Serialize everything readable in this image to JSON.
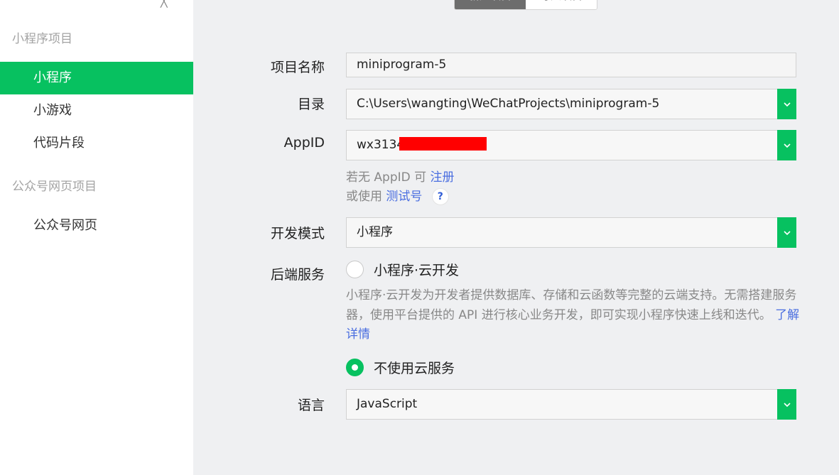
{
  "sidebar": {
    "sections": [
      {
        "title": "小程序项目",
        "items": [
          {
            "label": "小程序",
            "active": true
          },
          {
            "label": "小游戏",
            "active": false
          },
          {
            "label": "代码片段",
            "active": false
          }
        ]
      },
      {
        "title": "公众号网页项目",
        "items": [
          {
            "label": "公众号网页",
            "active": false
          }
        ]
      }
    ]
  },
  "tabs": [
    {
      "label": "新建项目",
      "active": true
    },
    {
      "label": "导入项目",
      "active": false
    }
  ],
  "form": {
    "project_name": {
      "label": "项目名称",
      "value": "miniprogram-5"
    },
    "directory": {
      "label": "目录",
      "value": "C:\\Users\\wangting\\WeChatProjects\\miniprogram-5"
    },
    "appid": {
      "label": "AppID",
      "value": "wx3134",
      "hint_prefix": "若无 AppID 可",
      "register_link": "注册",
      "test_prefix": "或使用",
      "test_link": "测试号",
      "help_icon": "?"
    },
    "dev_mode": {
      "label": "开发模式",
      "value": "小程序"
    },
    "backend": {
      "label": "后端服务",
      "cloud_option": "小程序·云开发",
      "cloud_checked": false,
      "description": "小程序·云开发为开发者提供数据库、存储和云函数等完整的云端支持。无需搭建服务器，使用平台提供的 API 进行核心业务开发，即可实现小程序快速上线和迭代。",
      "learn_more": "了解详情",
      "no_cloud_option": "不使用云服务",
      "no_cloud_checked": true
    },
    "language": {
      "label": "语言",
      "value": "JavaScript"
    }
  },
  "colors": {
    "accent": "#07c160",
    "link": "#4a6ee0",
    "redaction": "#ff0000"
  }
}
